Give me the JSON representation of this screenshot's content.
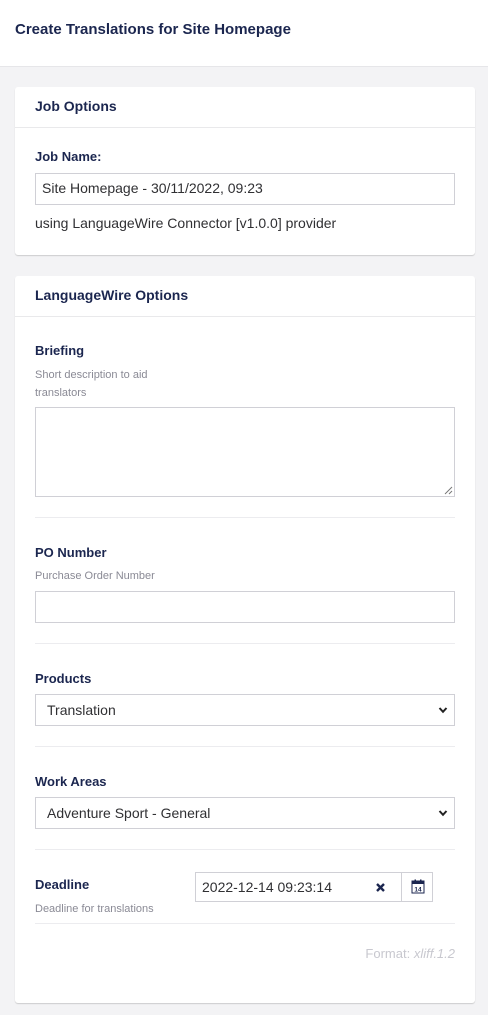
{
  "header": {
    "title": "Create Translations for Site Homepage"
  },
  "job_options": {
    "title": "Job Options",
    "job_name_label": "Job Name:",
    "job_name_value": "Site Homepage - 30/11/2022, 09:23",
    "provider_text": "using LanguageWire Connector [v1.0.0] provider"
  },
  "lw_options": {
    "title": "LanguageWire Options",
    "briefing": {
      "label": "Briefing",
      "description_line1": "Short description to aid",
      "description_line2": "translators",
      "value": ""
    },
    "po_number": {
      "label": "PO Number",
      "description": "Purchase Order Number",
      "value": ""
    },
    "products": {
      "label": "Products",
      "selected": "Translation"
    },
    "work_areas": {
      "label": "Work Areas",
      "selected": "Adventure Sport - General"
    },
    "deadline": {
      "label": "Deadline",
      "description": "Deadline for translations",
      "value": "2022-12-14 09:23:14",
      "calendar_day": "14"
    },
    "format": {
      "prefix": "Format: ",
      "value": "xliff.1.2"
    }
  },
  "icons": {
    "select_chevron": "chevron-down-icon",
    "clear": "close-icon",
    "calendar": "calendar-icon",
    "resize": "resize-handle-icon"
  },
  "colors": {
    "text_primary": "#1b264f",
    "background": "#f3f3f5",
    "muted": "#8a8a95",
    "border": "#d0d0d6"
  }
}
